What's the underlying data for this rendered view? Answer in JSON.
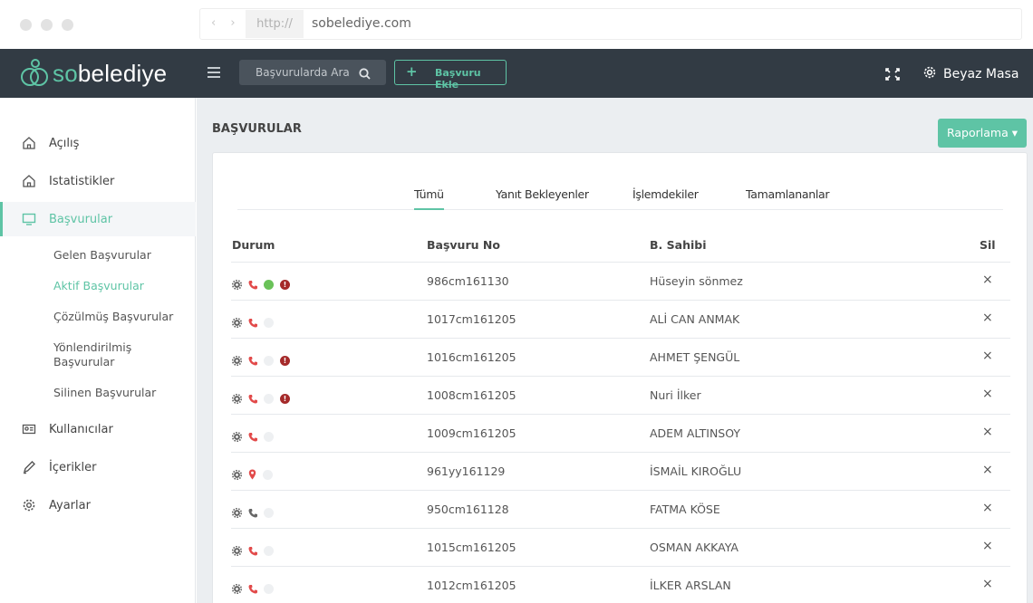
{
  "browser": {
    "proto": "http://",
    "url": "sobelediye.com"
  },
  "header": {
    "logo_so": "so",
    "logo_rest": "belediye",
    "search_placeholder": "Başvurularda Ara",
    "add_label": "Başvuru Ekle",
    "user_label": "Beyaz Masa"
  },
  "sidebar": {
    "items": [
      {
        "label": "Açılış",
        "icon": "home-icon"
      },
      {
        "label": "Istatistikler",
        "icon": "home-icon"
      },
      {
        "label": "Başvurular",
        "icon": "monitor-icon"
      },
      {
        "label": "Kullanıcılar",
        "icon": "id-card-icon"
      },
      {
        "label": "İçerikler",
        "icon": "pencil-icon"
      },
      {
        "label": "Ayarlar",
        "icon": "gear-icon"
      }
    ],
    "sub_items": [
      "Gelen Başvurular",
      "Aktif Başvurular",
      "Çözülmüş Başvurular",
      "Yönlendirilmiş Başvurular",
      "Silinen Başvurular"
    ]
  },
  "main": {
    "title": "BAŞVURULAR",
    "report_label": "Raporlama ▾",
    "tabs": [
      "Tümü",
      "Yanıt Bekleyenler",
      "İşlemdekiler",
      "Tamamlananlar"
    ],
    "columns": [
      "Durum",
      "Başvuru No",
      "B. Sahibi",
      "Sil"
    ],
    "rows": [
      {
        "no": "986cm161130",
        "owner": "Hüseyin sönmez",
        "contact": "phone",
        "dot": "green",
        "warn": true
      },
      {
        "no": "1017cm161205",
        "owner": "ALİ CAN ANMAK",
        "contact": "phone",
        "dot": "gray",
        "warn": false
      },
      {
        "no": "1016cm161205",
        "owner": "AHMET ŞENGÜL",
        "contact": "phone",
        "dot": "gray",
        "warn": true
      },
      {
        "no": "1008cm161205",
        "owner": "Nuri İlker",
        "contact": "phone",
        "dot": "gray",
        "warn": true
      },
      {
        "no": "1009cm161205",
        "owner": "ADEM ALTINSOY",
        "contact": "phone",
        "dot": "gray",
        "warn": false
      },
      {
        "no": "961yy161129",
        "owner": "İSMAİL KIROĞLU",
        "contact": "pin",
        "dot": "gray",
        "warn": false
      },
      {
        "no": "950cm161128",
        "owner": "FATMA KÖSE",
        "contact": "phone-gray",
        "dot": "gray",
        "warn": false
      },
      {
        "no": "1015cm161205",
        "owner": "OSMAN AKKAYA",
        "contact": "phone",
        "dot": "gray",
        "warn": false
      },
      {
        "no": "1012cm161205",
        "owner": "İLKER ARSLAN",
        "contact": "phone",
        "dot": "gray",
        "warn": false
      }
    ],
    "delete_glyph": "×",
    "warn_glyph": "!"
  },
  "colors": {
    "accent": "#5ec4a5",
    "header_bg": "#323b44",
    "warn": "#a52a2a",
    "phone": "#e24a4a"
  }
}
